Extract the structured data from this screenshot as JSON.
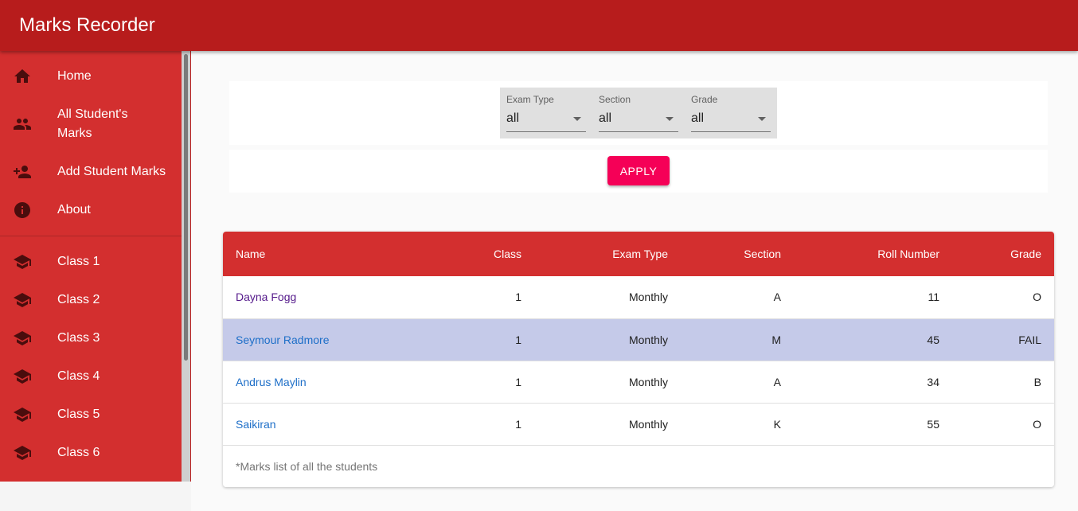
{
  "app": {
    "title": "Marks Recorder"
  },
  "nav": {
    "main": [
      {
        "label": "Home",
        "icon": "home-icon"
      },
      {
        "label": "All Student's Marks",
        "icon": "people-icon"
      },
      {
        "label": "Add Student Marks",
        "icon": "person-add-icon"
      },
      {
        "label": "About",
        "icon": "info-icon"
      }
    ],
    "classes": [
      {
        "label": "Class 1",
        "icon": "school-icon"
      },
      {
        "label": "Class 2",
        "icon": "school-icon"
      },
      {
        "label": "Class 3",
        "icon": "school-icon"
      },
      {
        "label": "Class 4",
        "icon": "school-icon"
      },
      {
        "label": "Class 5",
        "icon": "school-icon"
      },
      {
        "label": "Class 6",
        "icon": "school-icon"
      }
    ]
  },
  "filters": {
    "exam_type": {
      "label": "Exam Type",
      "value": "all"
    },
    "section": {
      "label": "Section",
      "value": "all"
    },
    "grade": {
      "label": "Grade",
      "value": "all"
    },
    "apply_label": "APPLY"
  },
  "table": {
    "headers": [
      "Name",
      "Class",
      "Exam Type",
      "Section",
      "Roll Number",
      "Grade"
    ],
    "rows": [
      {
        "name": "Dayna Fogg",
        "class": "1",
        "exam_type": "Monthly",
        "section": "A",
        "roll": "11",
        "grade": "O"
      },
      {
        "name": "Seymour Radmore",
        "class": "1",
        "exam_type": "Monthly",
        "section": "M",
        "roll": "45",
        "grade": "FAIL"
      },
      {
        "name": "Andrus Maylin",
        "class": "1",
        "exam_type": "Monthly",
        "section": "A",
        "roll": "34",
        "grade": "B"
      },
      {
        "name": "Saikiran",
        "class": "1",
        "exam_type": "Monthly",
        "section": "K",
        "roll": "55",
        "grade": "O"
      }
    ],
    "caption": "*Marks list of all the students"
  },
  "colors": {
    "appbar": "#b71c1c",
    "drawer": "#d32f2f",
    "accent": "#f50057",
    "selected_row": "#c5cae9"
  }
}
